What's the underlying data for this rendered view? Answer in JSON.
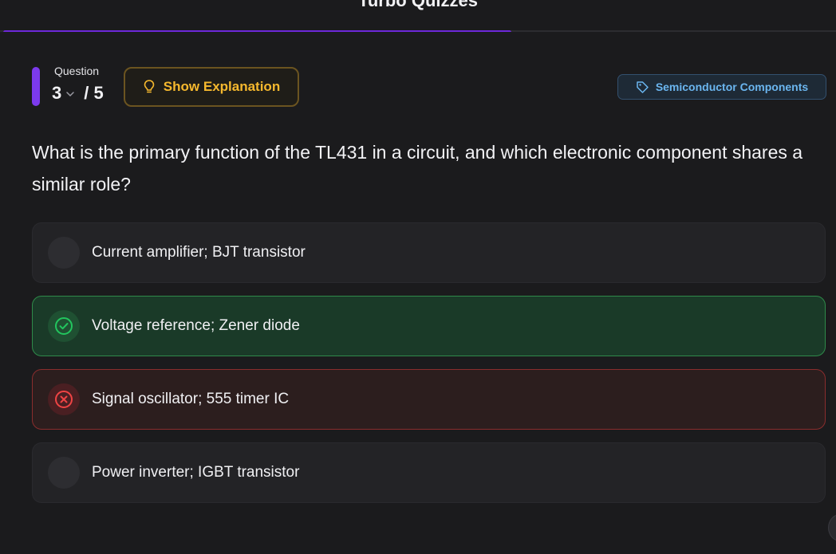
{
  "app": {
    "title": "Turbo Quizzes"
  },
  "progress": {
    "fraction": 0.61
  },
  "question_header": {
    "label": "Question",
    "current": "3",
    "total": "/ 5"
  },
  "explanation_button": {
    "label": "Show Explanation",
    "icon": "lightbulb-icon",
    "color": "#f5b82e"
  },
  "topic_tag": {
    "label": "Semiconductor Components",
    "icon": "tag-icon",
    "color": "#6bb6f0"
  },
  "question": {
    "text": "What is the primary function of the TL431 in a circuit, and which electronic component shares a similar role?"
  },
  "options": [
    {
      "label": "Current amplifier; BJT transistor",
      "state": "neutral"
    },
    {
      "label": "Voltage reference; Zener diode",
      "state": "correct",
      "icon": "check-circle-icon",
      "color": "#22c55e"
    },
    {
      "label": "Signal oscillator; 555 timer IC",
      "state": "wrong",
      "icon": "x-circle-icon",
      "color": "#ef4444"
    },
    {
      "label": "Power inverter; IGBT transistor",
      "state": "neutral"
    }
  ],
  "colors": {
    "accent": "#7c3aed",
    "background": "#1b1b1d"
  }
}
